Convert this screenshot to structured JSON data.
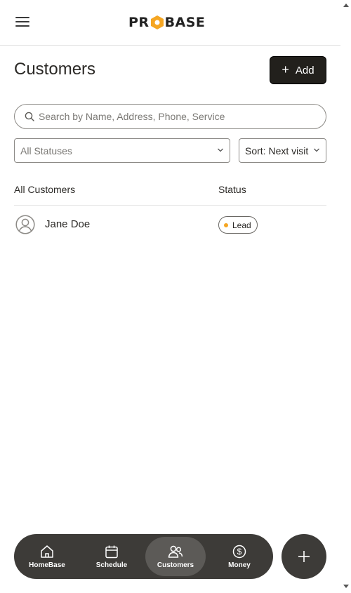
{
  "header": {
    "logo_text_left": "PR",
    "logo_text_right": "BASE",
    "menu_icon": "hamburger-icon"
  },
  "page": {
    "title": "Customers",
    "add_label": "Add"
  },
  "search": {
    "placeholder": "Search by Name, Address, Phone, Service"
  },
  "filters": {
    "status_value": "All Statuses",
    "sort_value": "Sort: Next visit"
  },
  "table": {
    "col_name": "All Customers",
    "col_status": "Status",
    "rows": [
      {
        "name": "Jane Doe",
        "status": "Lead"
      }
    ]
  },
  "nav": {
    "items": [
      {
        "label": "HomeBase",
        "icon": "home-icon"
      },
      {
        "label": "Schedule",
        "icon": "calendar-icon"
      },
      {
        "label": "Customers",
        "icon": "users-icon",
        "active": true
      },
      {
        "label": "Money",
        "icon": "dollar-icon"
      }
    ]
  },
  "colors": {
    "dark": "#22201c",
    "nav_bg": "#3d3b38",
    "nav_active": "#5c5a57",
    "lead_dot": "#f5a623",
    "logo_hex": "#f5a623"
  }
}
